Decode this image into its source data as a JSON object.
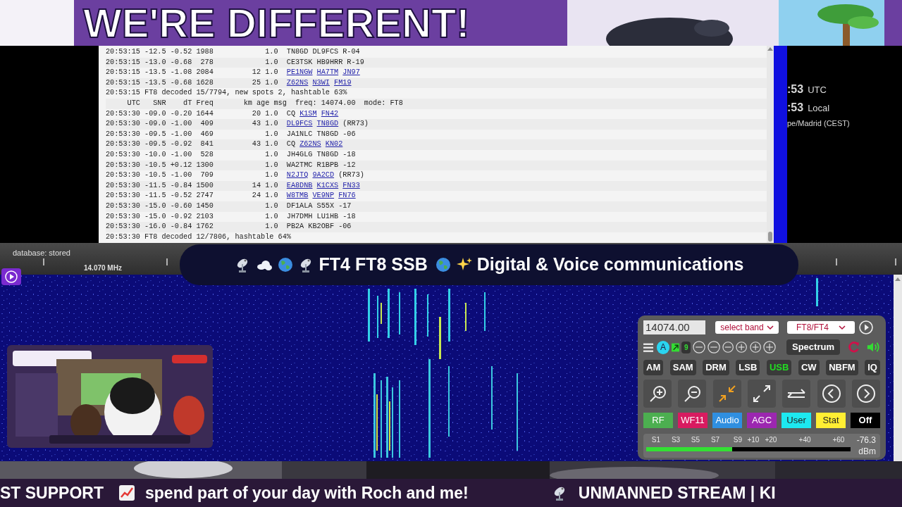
{
  "banner": {
    "title": "WE'RE DIFFERENT!"
  },
  "decode_log": {
    "rows": [
      {
        "kind": "decode",
        "time": "20:53:15",
        "snr": "-12.5",
        "dt": "-0.52",
        "freq": "1988",
        "km": "",
        "age": "1.0",
        "msg": [
          {
            "text": "TN8GD DL9FCS R-04",
            "link": false
          }
        ]
      },
      {
        "kind": "decode",
        "time": "20:53:15",
        "snr": "-13.0",
        "dt": "-0.68",
        "freq": "278",
        "km": "",
        "age": "1.0",
        "msg": [
          {
            "text": "CE3TSK HB9HRR R-19",
            "link": false
          }
        ]
      },
      {
        "kind": "decode",
        "time": "20:53:15",
        "snr": "-13.5",
        "dt": "-1.08",
        "freq": "2084",
        "km": "12",
        "age": "1.0",
        "msg": [
          {
            "text": "PE1NGW",
            "link": true
          },
          {
            "text": "HA7TM",
            "link": true
          },
          {
            "text": "JN97",
            "link": true
          }
        ]
      },
      {
        "kind": "decode",
        "time": "20:53:15",
        "snr": "-13.5",
        "dt": "-0.68",
        "freq": "1628",
        "km": "25",
        "age": "1.0",
        "msg": [
          {
            "text": "Z62NS",
            "link": true
          },
          {
            "text": "N3WI",
            "link": true
          },
          {
            "text": "FM19",
            "link": true
          }
        ]
      },
      {
        "kind": "summary",
        "text": "20:53:15 FT8 decoded 15/7794, new spots 2, hashtable 63%"
      },
      {
        "kind": "header",
        "text": "     UTC   SNR    dT Freq       km age msg  freq: 14074.00  mode: FT8"
      },
      {
        "kind": "decode",
        "time": "20:53:30",
        "snr": "-09.0",
        "dt": "-0.20",
        "freq": "1644",
        "km": "20",
        "age": "1.0",
        "msg": [
          {
            "text": "CQ",
            "link": false
          },
          {
            "text": "K1SM",
            "link": true
          },
          {
            "text": "FN42",
            "link": true
          }
        ]
      },
      {
        "kind": "decode",
        "time": "20:53:30",
        "snr": "-09.0",
        "dt": "-1.00",
        "freq": "409",
        "km": "43",
        "age": "1.0",
        "msg": [
          {
            "text": "DL9FCS",
            "link": true
          },
          {
            "text": "TN8GD",
            "link": true
          },
          {
            "text": "(RR73)",
            "link": false
          }
        ]
      },
      {
        "kind": "decode",
        "time": "20:53:30",
        "snr": "-09.5",
        "dt": "-1.00",
        "freq": "469",
        "km": "",
        "age": "1.0",
        "msg": [
          {
            "text": "JA1NLC TN8GD -06",
            "link": false
          }
        ]
      },
      {
        "kind": "decode",
        "time": "20:53:30",
        "snr": "-09.5",
        "dt": "-0.92",
        "freq": "841",
        "km": "43",
        "age": "1.0",
        "msg": [
          {
            "text": "CQ",
            "link": false
          },
          {
            "text": "Z62NS",
            "link": true
          },
          {
            "text": "KN02",
            "link": true
          }
        ]
      },
      {
        "kind": "decode",
        "time": "20:53:30",
        "snr": "-10.0",
        "dt": "-1.00",
        "freq": "528",
        "km": "",
        "age": "1.0",
        "msg": [
          {
            "text": "JH4GLG TN8GD -18",
            "link": false
          }
        ]
      },
      {
        "kind": "decode",
        "time": "20:53:30",
        "snr": "-10.5",
        "dt": "+0.12",
        "freq": "1300",
        "km": "",
        "age": "1.0",
        "msg": [
          {
            "text": "WA2TMC R1BPB -12",
            "link": false
          }
        ]
      },
      {
        "kind": "decode",
        "time": "20:53:30",
        "snr": "-10.5",
        "dt": "-1.00",
        "freq": "709",
        "km": "",
        "age": "1.0",
        "msg": [
          {
            "text": "N2JTQ",
            "link": true
          },
          {
            "text": "9A2CD",
            "link": true
          },
          {
            "text": "(RR73)",
            "link": false
          }
        ]
      },
      {
        "kind": "decode",
        "time": "20:53:30",
        "snr": "-11.5",
        "dt": "-0.84",
        "freq": "1500",
        "km": "14",
        "age": "1.0",
        "msg": [
          {
            "text": "EA8DNB",
            "link": true
          },
          {
            "text": "K1CXS",
            "link": true
          },
          {
            "text": "FN33",
            "link": true
          }
        ]
      },
      {
        "kind": "decode",
        "time": "20:53:30",
        "snr": "-11.5",
        "dt": "-0.52",
        "freq": "2747",
        "km": "24",
        "age": "1.0",
        "msg": [
          {
            "text": "W8TMB",
            "link": true
          },
          {
            "text": "VE9NP",
            "link": true
          },
          {
            "text": "FN76",
            "link": true
          }
        ]
      },
      {
        "kind": "decode",
        "time": "20:53:30",
        "snr": "-15.0",
        "dt": "-0.60",
        "freq": "1450",
        "km": "",
        "age": "1.0",
        "msg": [
          {
            "text": "DF1ALA S55X -17",
            "link": false
          }
        ]
      },
      {
        "kind": "decode",
        "time": "20:53:30",
        "snr": "-15.0",
        "dt": "-0.92",
        "freq": "2103",
        "km": "",
        "age": "1.0",
        "msg": [
          {
            "text": "JH7DMH LU1HB -18",
            "link": false
          }
        ]
      },
      {
        "kind": "decode",
        "time": "20:53:30",
        "snr": "-16.0",
        "dt": "-0.84",
        "freq": "1762",
        "km": "",
        "age": "1.0",
        "msg": [
          {
            "text": "PB2A KB2OBF -06",
            "link": false
          }
        ]
      },
      {
        "kind": "summary",
        "text": "20:53:30 FT8 decoded 12/7806, hashtable 64%"
      }
    ]
  },
  "clock": {
    "utc_time": ":53",
    "utc_label": "UTC",
    "local_time": ":53",
    "local_label": "Local",
    "timezone": "pe/Madrid (CEST)"
  },
  "scale": {
    "status": "database: stored",
    "frequency": "14.070 MHz"
  },
  "overlay_banner": {
    "parts": [
      "FT4 FT8 SSB",
      "Digital & Voice communications"
    ]
  },
  "control_panel": {
    "frequency": "14074.00",
    "band_select": "select band",
    "mode_select": "FT8/FT4",
    "auto_badge": "A",
    "count_badge": "9",
    "spectrum_button": "Spectrum",
    "modes": [
      {
        "label": "AM",
        "selected": false
      },
      {
        "label": "SAM",
        "selected": false
      },
      {
        "label": "DRM",
        "selected": false
      },
      {
        "label": "LSB",
        "selected": false
      },
      {
        "label": "USB",
        "selected": true
      },
      {
        "label": "CW",
        "selected": false
      },
      {
        "label": "NBFM",
        "selected": false
      },
      {
        "label": "IQ",
        "selected": false
      }
    ],
    "toggles": [
      {
        "label": "RF",
        "color": "#4caf50"
      },
      {
        "label": "WF11",
        "color": "#d81b60"
      },
      {
        "label": "Audio",
        "color": "#2f8fe0"
      },
      {
        "label": "AGC",
        "color": "#9c27b0"
      },
      {
        "label": "User",
        "color": "#1de9f0"
      },
      {
        "label": "Stat",
        "color": "#ffee33"
      },
      {
        "label": "Off",
        "color": "#000000"
      }
    ],
    "smeter": {
      "scale": [
        "S1",
        "S3",
        "S5",
        "S7",
        "S9",
        "+10",
        "+20",
        "+40",
        "+60"
      ],
      "level": 0.42,
      "reading": "-76.3",
      "unit": "dBm"
    }
  },
  "ticker": {
    "parts": [
      "ST SUPPORT",
      "spend part of your day with Roch and me!",
      "UNMANNED STREAM | KI"
    ]
  }
}
